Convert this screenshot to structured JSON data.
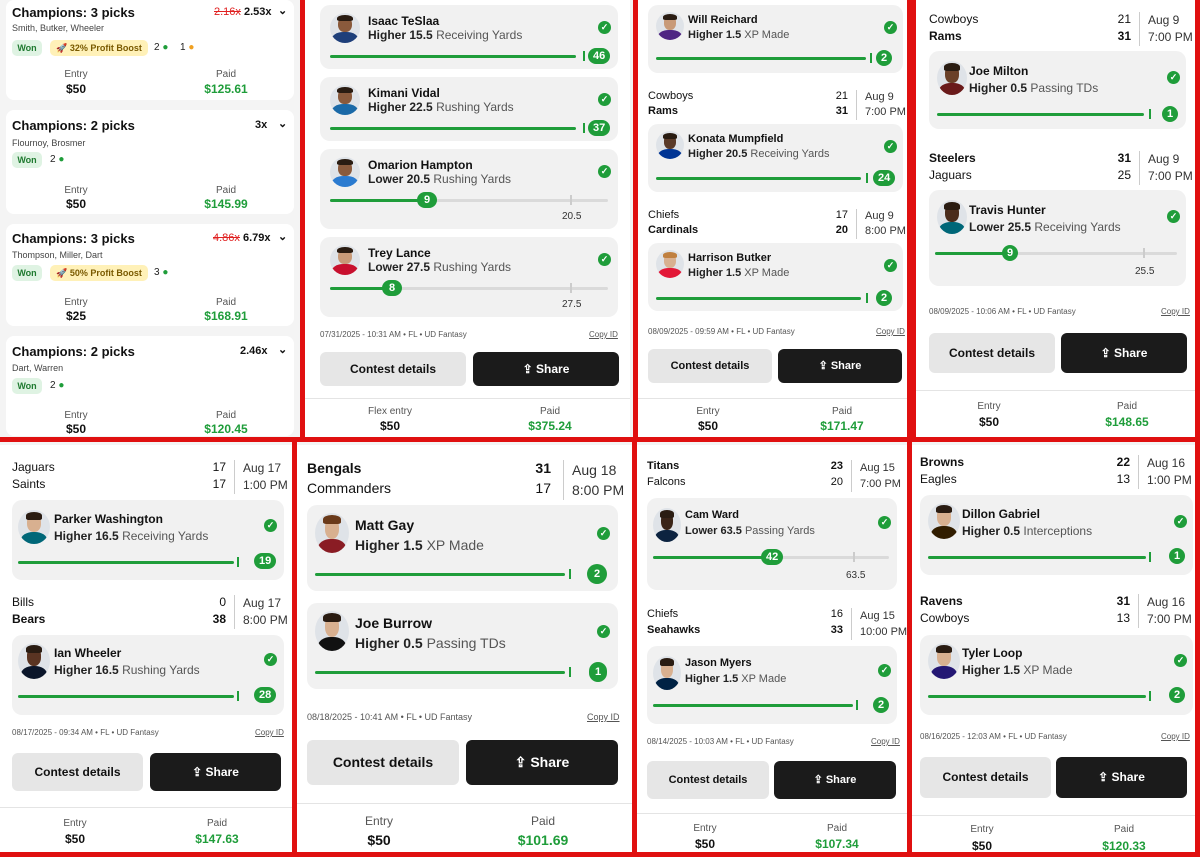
{
  "share_label": "Share",
  "contest_details_label": "Contest details",
  "copy_id_label": "Copy ID",
  "entry_label": "Entry",
  "paid_label": "Paid",
  "flex_entry_label": "Flex entry",
  "won_label": "Won",
  "colors": {
    "green": "#1f9d3a",
    "frame_red": "#e01010",
    "dark_button": "#1b1b1b"
  },
  "col1": {
    "entries": [
      {
        "title": "Champions: 3 picks",
        "old_mult": "2.16x",
        "mult": "2.53x",
        "players": "Smith, Butker, Wheeler",
        "boost": "32% Profit Boost",
        "wins": "2",
        "pending": "1",
        "entry": "$50",
        "paid": "$125.61"
      },
      {
        "title": "Champions: 2 picks",
        "old_mult": "",
        "mult": "3x",
        "players": "Flournoy, Brosmer",
        "boost": "",
        "wins": "2",
        "pending": "",
        "entry": "$50",
        "paid": "$145.99"
      },
      {
        "title": "Champions: 3 picks",
        "old_mult": "4.86x",
        "mult": "6.79x",
        "players": "Thompson, Miller, Dart",
        "boost": "50% Profit Boost",
        "wins": "3",
        "pending": "",
        "entry": "$25",
        "paid": "$168.91"
      },
      {
        "title": "Champions: 2 picks",
        "old_mult": "",
        "mult": "2.46x",
        "players": "Dart, Warren",
        "boost": "",
        "wins": "2",
        "pending": "",
        "entry": "$50",
        "paid": "$120.45"
      }
    ]
  },
  "p2": {
    "picks": [
      {
        "name": "Isaac TeSlaa",
        "dir": "Higher",
        "line": "15.5",
        "stat": "Receiving Yards",
        "result": "46",
        "progress": 1.0
      },
      {
        "name": "Kimani Vidal",
        "dir": "Higher",
        "line": "22.5",
        "stat": "Rushing Yards",
        "result": "37",
        "progress": 1.0
      },
      {
        "name": "Omarion Hampton",
        "dir": "Lower",
        "line": "20.5",
        "stat": "Rushing Yards",
        "result": "9",
        "target": "20.5",
        "progress": 0.39
      },
      {
        "name": "Trey Lance",
        "dir": "Lower",
        "line": "27.5",
        "stat": "Rushing Yards",
        "result": "8",
        "target": "27.5",
        "progress": 0.24
      }
    ],
    "meta": "07/31/2025 - 10:31 AM • FL • UD Fantasy",
    "entry": "$50",
    "paid": "$375.24"
  },
  "p3": {
    "groups": [
      {
        "team1": "",
        "team2": "",
        "picks": [
          {
            "name": "Will Reichard",
            "dir": "Higher",
            "line": "1.5",
            "stat": "XP Made",
            "result": "2"
          }
        ]
      },
      {
        "team1": "Cowboys",
        "score1": "21",
        "team2": "Rams",
        "score2": "31",
        "date": "Aug 9",
        "time": "7:00 PM",
        "picks": [
          {
            "name": "Konata Mumpfield",
            "dir": "Higher",
            "line": "20.5",
            "stat": "Receiving Yards",
            "result": "24"
          }
        ]
      },
      {
        "team1": "Chiefs",
        "score1": "17",
        "team2": "Cardinals",
        "score2": "20",
        "date": "Aug 9",
        "time": "8:00 PM",
        "picks": [
          {
            "name": "Harrison Butker",
            "dir": "Higher",
            "line": "1.5",
            "stat": "XP Made",
            "result": "2"
          }
        ]
      }
    ],
    "meta": "08/09/2025 - 09:59 AM • FL • UD Fantasy",
    "entry": "$50",
    "paid": "$171.47"
  },
  "p4": {
    "groups": [
      {
        "team1": "Cowboys",
        "score1": "21",
        "team2": "Rams",
        "score2": "31",
        "date": "Aug 9",
        "time": "7:00 PM",
        "pick": {
          "name": "Joe Milton",
          "dir": "Higher",
          "line": "0.5",
          "stat": "Passing TDs",
          "result": "1"
        }
      },
      {
        "team1": "Steelers",
        "score1": "31",
        "team2": "Jaguars",
        "score2": "25",
        "date": "Aug 9",
        "time": "7:00 PM",
        "pick": {
          "name": "Travis Hunter",
          "dir": "Lower",
          "line": "25.5",
          "stat": "Receiving Yards",
          "result": "9",
          "target": "25.5",
          "progress": 0.35
        }
      }
    ],
    "meta": "08/09/2025 - 10:06 AM • FL • UD Fantasy",
    "entry": "$50",
    "paid": "$148.65"
  },
  "p5": {
    "groups": [
      {
        "team1": "Jaguars",
        "score1": "17",
        "team2": "Saints",
        "score2": "17",
        "date": "Aug 17",
        "time": "1:00 PM",
        "pick": {
          "name": "Parker Washington",
          "dir": "Higher",
          "line": "16.5",
          "stat": "Receiving Yards",
          "result": "19"
        }
      },
      {
        "team1": "Bills",
        "score1": "0",
        "team2": "Bears",
        "score2": "38",
        "date": "Aug 17",
        "time": "8:00 PM",
        "pick": {
          "name": "Ian Wheeler",
          "dir": "Higher",
          "line": "16.5",
          "stat": "Rushing Yards",
          "result": "28"
        }
      }
    ],
    "meta": "08/17/2025 - 09:34 AM • FL • UD Fantasy",
    "entry": "$50",
    "paid": "$147.63"
  },
  "p6": {
    "team1": "Bengals",
    "score1": "31",
    "team2": "Commanders",
    "score2": "17",
    "date": "Aug 18",
    "time": "8:00 PM",
    "picks": [
      {
        "name": "Matt Gay",
        "dir": "Higher",
        "line": "1.5",
        "stat": "XP Made",
        "result": "2"
      },
      {
        "name": "Joe Burrow",
        "dir": "Higher",
        "line": "0.5",
        "stat": "Passing TDs",
        "result": "1"
      }
    ],
    "meta": "08/18/2025 - 10:41 AM • FL • UD Fantasy",
    "entry": "$50",
    "paid": "$101.69"
  },
  "p7": {
    "groups": [
      {
        "team1": "Titans",
        "score1": "23",
        "team2": "Falcons",
        "score2": "20",
        "date": "Aug 15",
        "time": "7:00 PM",
        "pick": {
          "name": "Cam Ward",
          "dir": "Lower",
          "line": "63.5",
          "stat": "Passing Yards",
          "result": "42",
          "target": "63.5",
          "progress": 0.6
        }
      },
      {
        "team1": "Chiefs",
        "score1": "16",
        "team2": "Seahawks",
        "score2": "33",
        "date": "Aug 15",
        "time": "10:00 PM",
        "pick": {
          "name": "Jason Myers",
          "dir": "Higher",
          "line": "1.5",
          "stat": "XP Made",
          "result": "2"
        }
      }
    ],
    "meta": "08/14/2025 - 10:03 AM • FL • UD Fantasy",
    "entry": "$50",
    "paid": "$107.34"
  },
  "p8": {
    "groups": [
      {
        "team1": "Browns",
        "score1": "22",
        "team2": "Eagles",
        "score2": "13",
        "date": "Aug 16",
        "time": "1:00 PM",
        "pick": {
          "name": "Dillon Gabriel",
          "dir": "Higher",
          "line": "0.5",
          "stat": "Interceptions",
          "result": "1"
        }
      },
      {
        "team1": "Ravens",
        "score1": "31",
        "team2": "Cowboys",
        "score2": "13",
        "date": "Aug 16",
        "time": "7:00 PM",
        "pick": {
          "name": "Tyler Loop",
          "dir": "Higher",
          "line": "1.5",
          "stat": "XP Made",
          "result": "2"
        }
      }
    ],
    "meta": "08/16/2025 - 12:03 AM • FL • UD Fantasy",
    "entry": "$50",
    "paid": "$120.33"
  }
}
